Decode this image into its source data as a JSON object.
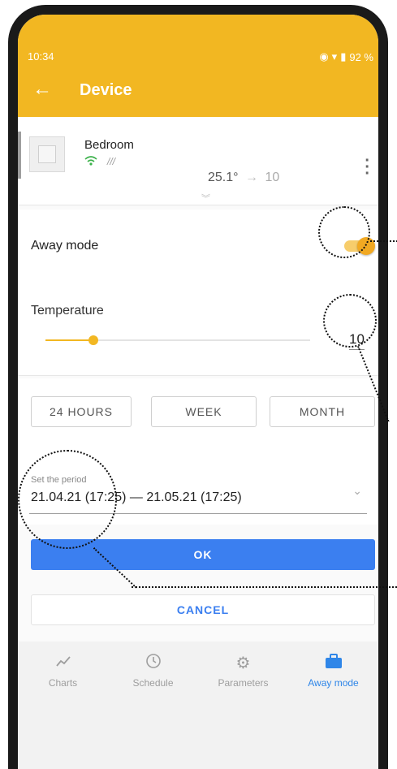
{
  "status": {
    "time": "10:34",
    "battery": "92 %"
  },
  "appbar": {
    "title": "Device",
    "back_icon": "arrow-left-icon"
  },
  "device": {
    "name": "Bedroom",
    "signal": "///",
    "current_temp": "25.1°",
    "arrow": "→",
    "target_temp": "10"
  },
  "away": {
    "label": "Away mode",
    "enabled": true
  },
  "temperature": {
    "label": "Temperature",
    "value": "10",
    "slider_fraction": 0.18
  },
  "period_tabs": [
    "24 HOURS",
    "WEEK",
    "MONTH"
  ],
  "period": {
    "label": "Set the period",
    "value": "21.04.21 (17:25) — 21.05.21 (17:25)"
  },
  "buttons": {
    "ok": "OK",
    "cancel": "CANCEL"
  },
  "nav": [
    {
      "label": "Charts",
      "icon": "chart-line-icon"
    },
    {
      "label": "Schedule",
      "icon": "clock-icon"
    },
    {
      "label": "Parameters",
      "icon": "gear-icon"
    },
    {
      "label": "Away mode",
      "icon": "briefcase-icon",
      "active": true
    }
  ],
  "colors": {
    "accent": "#f2b722",
    "primary": "#3b7ff0"
  }
}
